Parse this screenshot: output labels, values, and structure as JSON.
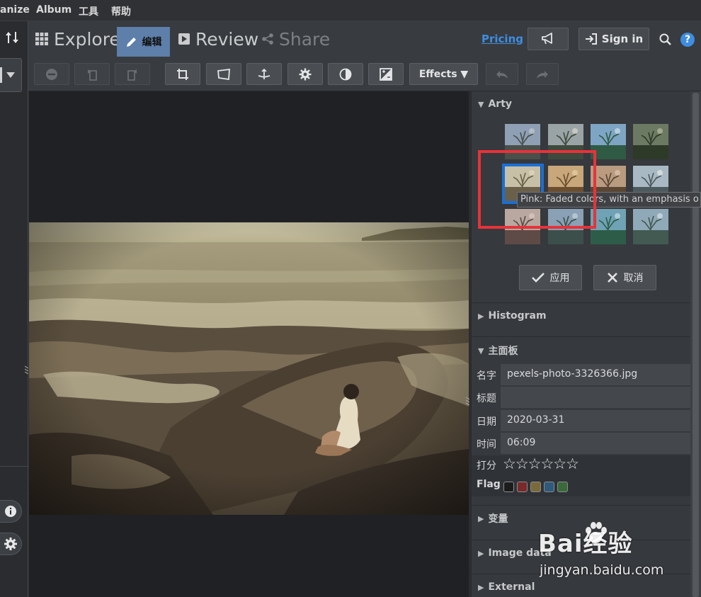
{
  "menubar": {
    "items": [
      "anize",
      "Album",
      "工具",
      "帮助"
    ]
  },
  "nav": {
    "explore": "Explore",
    "edit": "编辑",
    "review": "Review",
    "share": "Share",
    "pricing": "Pricing",
    "sign_in": "Sign in"
  },
  "toolbar": {
    "effects_label": "Effects ▼"
  },
  "panel": {
    "arty_title": "Arty",
    "tooltip": "Pink: Faded colors, with an emphasis o",
    "apply_label": "应用",
    "cancel_label": "取消",
    "histogram_title": "Histogram",
    "main_title": "主面板",
    "fields": {
      "name_label": "名字",
      "name_value": "pexels-photo-3326366.jpg",
      "title_label": "标题",
      "title_value": "",
      "date_label": "日期",
      "date_value": "2020-03-31",
      "time_label": "时间",
      "time_value": "06:09",
      "rating_label": "打分",
      "rating_stars": "☆☆☆☆☆☆",
      "flag_label": "Flag"
    },
    "flag_colors": [
      "#1c1c1c",
      "#7a2a2a",
      "#7a6a3a",
      "#2f5a7a",
      "#3a6a3a"
    ],
    "variables_title": "变量",
    "image_data_title": "Image data",
    "external_title": "External"
  },
  "watermark": {
    "brand": "Bai经验",
    "url": "jingyan.baidu.com"
  },
  "colors": {
    "accent": "#5d7fa9",
    "link": "#3f8de0",
    "highlight": "#e8323a",
    "selected": "#1a6fd8"
  }
}
